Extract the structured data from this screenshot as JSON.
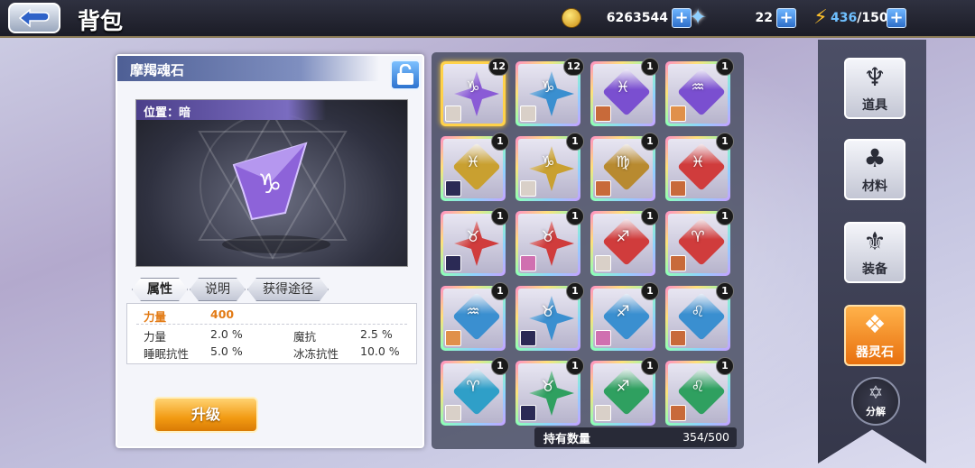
{
  "header": {
    "title": "背包",
    "gold": "6263544",
    "crystal": "22",
    "stamina_current": "436",
    "stamina_sep": "/150"
  },
  "detail": {
    "name": "摩羯魂石",
    "position_label": "位置：暗",
    "tabs": [
      "属性",
      "说明",
      "获得途径"
    ],
    "main_stat": {
      "label": "力量",
      "value": "400"
    },
    "stats": [
      {
        "label": "力量",
        "value": "2.0 %"
      },
      {
        "label": "魔抗",
        "value": "2.5 %"
      },
      {
        "label": "睡眠抗性",
        "value": "5.0 %"
      },
      {
        "label": "冰冻抗性",
        "value": "10.0 %"
      }
    ],
    "upgrade_label": "升级"
  },
  "inventory": {
    "items": [
      {
        "count": "12",
        "color": "#8a5bd6",
        "shape": "star",
        "symbol": "♑",
        "avatar": "#d9d0c8",
        "selected": true
      },
      {
        "count": "12",
        "color": "#3a8fd0",
        "shape": "star",
        "symbol": "♑",
        "avatar": "#d9d0c8"
      },
      {
        "count": "1",
        "color": "#7a4fd0",
        "shape": "gem",
        "symbol": "♓",
        "avatar": "#c86a3a"
      },
      {
        "count": "1",
        "color": "#7a4fd0",
        "shape": "gem",
        "symbol": "♒",
        "avatar": "#e0904a"
      },
      {
        "count": "1",
        "color": "#c9a030",
        "shape": "gem",
        "symbol": "♓",
        "avatar": "#2b2a55"
      },
      {
        "count": "1",
        "color": "#c9a030",
        "shape": "star",
        "symbol": "♑",
        "avatar": "#d9d0c8"
      },
      {
        "count": "1",
        "color": "#b88a30",
        "shape": "gem",
        "symbol": "♍",
        "avatar": "#c86a3a"
      },
      {
        "count": "1",
        "color": "#d03c3c",
        "shape": "gem",
        "symbol": "♓",
        "avatar": "#c86a3a"
      },
      {
        "count": "1",
        "color": "#d03c3c",
        "shape": "star",
        "symbol": "♉",
        "avatar": "#2b2a55"
      },
      {
        "count": "1",
        "color": "#d03c3c",
        "shape": "star",
        "symbol": "♉",
        "avatar": "#d070b0"
      },
      {
        "count": "1",
        "color": "#d03c3c",
        "shape": "gem",
        "symbol": "♐",
        "avatar": "#d9d0c8"
      },
      {
        "count": "1",
        "color": "#d03c3c",
        "shape": "gem",
        "symbol": "♈",
        "avatar": "#c86a3a"
      },
      {
        "count": "1",
        "color": "#3a8fd0",
        "shape": "gem",
        "symbol": "♒",
        "avatar": "#e0904a"
      },
      {
        "count": "1",
        "color": "#3a8fd0",
        "shape": "star",
        "symbol": "♉",
        "avatar": "#2b2a55"
      },
      {
        "count": "1",
        "color": "#3a8fd0",
        "shape": "gem",
        "symbol": "♐",
        "avatar": "#d070b0"
      },
      {
        "count": "1",
        "color": "#3a8fd0",
        "shape": "gem",
        "symbol": "♌",
        "avatar": "#c86a3a"
      },
      {
        "count": "1",
        "color": "#2f9fc8",
        "shape": "gem",
        "symbol": "♈",
        "avatar": "#d9d0c8"
      },
      {
        "count": "1",
        "color": "#2fa060",
        "shape": "star",
        "symbol": "♉",
        "avatar": "#2b2a55"
      },
      {
        "count": "1",
        "color": "#2fa060",
        "shape": "gem",
        "symbol": "♐",
        "avatar": "#d9d0c8"
      },
      {
        "count": "1",
        "color": "#2fa060",
        "shape": "gem",
        "symbol": "♌",
        "avatar": "#c86a3a"
      }
    ],
    "capacity_label": "持有数量",
    "capacity_value": "354/500"
  },
  "side_nav": [
    {
      "label": "道具",
      "icon": "♆",
      "active": false
    },
    {
      "label": "材料",
      "icon": "♣",
      "active": false
    },
    {
      "label": "装备",
      "icon": "⚜",
      "active": false
    },
    {
      "label": "器灵石",
      "icon": "❖",
      "active": true
    }
  ],
  "decompose_label": "分解"
}
